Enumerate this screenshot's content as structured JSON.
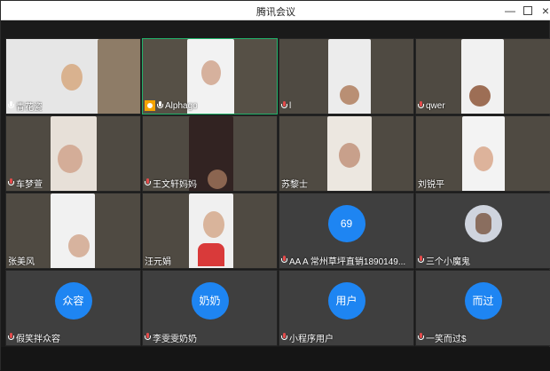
{
  "window": {
    "title": "腾讯会议"
  },
  "participants": [
    {
      "name": "青花瓷",
      "avatar_text": ""
    },
    {
      "name": "Alphago",
      "avatar_text": ""
    },
    {
      "name": "l",
      "avatar_text": ""
    },
    {
      "name": "qwer",
      "avatar_text": ""
    },
    {
      "name": "车梦萱",
      "avatar_text": ""
    },
    {
      "name": "王文轩妈妈",
      "avatar_text": ""
    },
    {
      "name": "苏黎士",
      "avatar_text": ""
    },
    {
      "name": "刘锐平",
      "avatar_text": ""
    },
    {
      "name": "张美风",
      "avatar_text": ""
    },
    {
      "name": "汪元娟",
      "avatar_text": ""
    },
    {
      "name": "AA A  常州草坪直销1890149...",
      "avatar_text": "69"
    },
    {
      "name": "三个小魔鬼",
      "avatar_text": ""
    },
    {
      "name": "假笑拌众容",
      "avatar_text": "众容"
    },
    {
      "name": "李雯雯奶奶",
      "avatar_text": "奶奶"
    },
    {
      "name": "小程序用户",
      "avatar_text": "用户"
    },
    {
      "name": "一笑而过$",
      "avatar_text": "而过"
    }
  ],
  "colors": {
    "accent": "#1e85f2",
    "active_border": "#21b36b",
    "tile_bg": "#3f3f3f"
  }
}
